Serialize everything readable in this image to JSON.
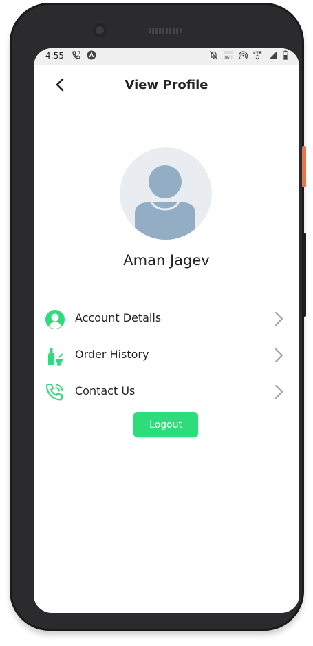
{
  "status_bar": {
    "time": "4:55",
    "icons_left": [
      "call-forward-icon",
      "app-notification-icon"
    ],
    "icons_right": [
      "mute-icon",
      "volte-icon",
      "hotspot-icon",
      "lte-icon",
      "signal-icon",
      "battery-icon"
    ]
  },
  "header": {
    "title": "View Profile",
    "back_icon": "chevron-left-icon"
  },
  "profile": {
    "name": "Aman Jagev",
    "avatar_icon": "user-placeholder-icon"
  },
  "menu": {
    "items": [
      {
        "label": "Account Details",
        "icon": "account-circle-icon"
      },
      {
        "label": "Order History",
        "icon": "bottles-icon"
      },
      {
        "label": "Contact Us",
        "icon": "phone-ringing-icon"
      }
    ]
  },
  "actions": {
    "logout_label": "Logout"
  },
  "colors": {
    "accent": "#2ddc7b",
    "avatar_bg": "#e9edf2",
    "avatar_figure": "#93adc4",
    "chevron": "#9e9e9e",
    "phone_frame": "#2b2b2d",
    "side_button": "#e8774e"
  }
}
